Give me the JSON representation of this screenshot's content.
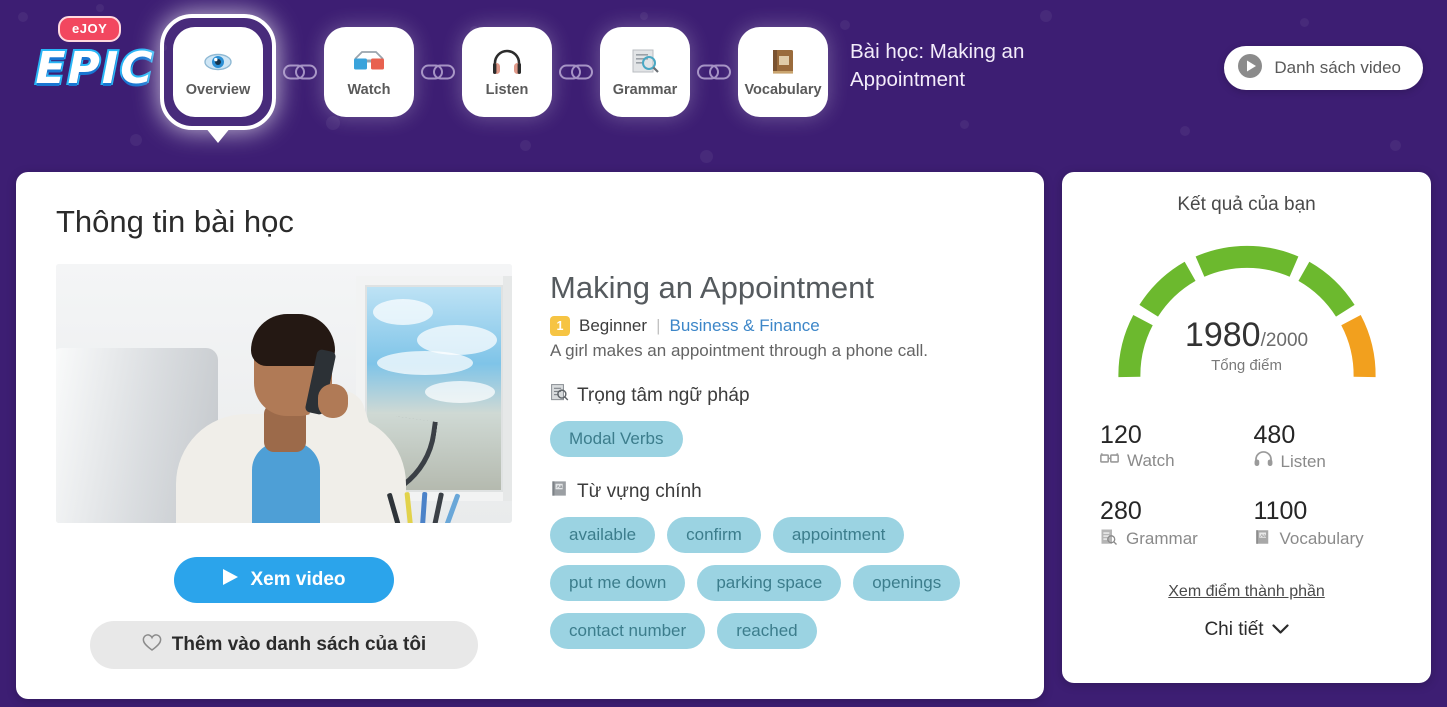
{
  "brand": {
    "badge": "eJOY",
    "name": "EPIC"
  },
  "nav": {
    "items": [
      {
        "label": "Overview",
        "icon": "eye-icon",
        "active": true
      },
      {
        "label": "Watch",
        "icon": "3d-glasses-icon",
        "active": false
      },
      {
        "label": "Listen",
        "icon": "headphones-icon",
        "active": false
      },
      {
        "label": "Grammar",
        "icon": "document-search-icon",
        "active": false
      },
      {
        "label": "Vocabulary",
        "icon": "book-icon",
        "active": false
      }
    ],
    "connector_icon": "chain-link-icon"
  },
  "header": {
    "lesson_title": "Bài học: Making an Appointment",
    "video_list_button": "Danh sách video",
    "video_list_icon": "play-circle-icon"
  },
  "lesson_card": {
    "section_title": "Thông tin bài học",
    "thumbnail_alt": "woman-on-phone-in-office",
    "watch_button": "Xem video",
    "watch_icon": "play-icon",
    "add_button": "Thêm vào danh sách của tôi",
    "add_icon": "heart-outline-icon",
    "title": "Making an Appointment",
    "level_badge": "1",
    "level_name": "Beginner",
    "meta_divider": "|",
    "category": "Business & Finance",
    "description": "A girl makes an appointment through a phone call.",
    "grammar_heading": "Trọng tâm ngữ pháp",
    "grammar_icon": "document-search-icon",
    "grammar_tags": [
      "Modal Verbs"
    ],
    "vocab_heading": "Từ vựng chính",
    "vocab_icon": "book-icon",
    "vocab_tags": [
      "available",
      "confirm",
      "appointment",
      "put me down",
      "parking space",
      "openings",
      "contact number",
      "reached"
    ]
  },
  "result_card": {
    "title": "Kết quả của bạn",
    "score": "1980",
    "total": "/2000",
    "score_label": "Tổng điểm",
    "breakdown": [
      {
        "value": "120",
        "name": "Watch",
        "icon": "3d-glasses-icon"
      },
      {
        "value": "480",
        "name": "Listen",
        "icon": "headphones-icon"
      },
      {
        "value": "280",
        "name": "Grammar",
        "icon": "document-search-icon"
      },
      {
        "value": "1100",
        "name": "Vocabulary",
        "icon": "book-icon"
      }
    ],
    "detail_link": "Xem điểm thành phần",
    "expand_label": "Chi tiết",
    "expand_icon": "chevron-down-icon"
  },
  "colors": {
    "page_background": "#3D1E73",
    "accent_blue": "#2BA4EB",
    "tag_blue": "#9BD3E2",
    "gauge_green": "#6CB92E",
    "gauge_orange": "#F2A01E",
    "badge_yellow": "#F6C443",
    "link_blue": "#3C86C8"
  },
  "chart_data": {
    "type": "gauge",
    "title": "Kết quả của bạn",
    "value": 1980,
    "max": 2000,
    "label": "Tổng điểm",
    "segments": [
      {
        "index": 1,
        "color": "#6CB92E"
      },
      {
        "index": 2,
        "color": "#6CB92E"
      },
      {
        "index": 3,
        "color": "#6CB92E"
      },
      {
        "index": 4,
        "color": "#6CB92E"
      },
      {
        "index": 5,
        "color": "#F2A01E"
      }
    ],
    "components": {
      "categories": [
        "Watch",
        "Listen",
        "Grammar",
        "Vocabulary"
      ],
      "values": [
        120,
        480,
        280,
        1100
      ]
    }
  }
}
